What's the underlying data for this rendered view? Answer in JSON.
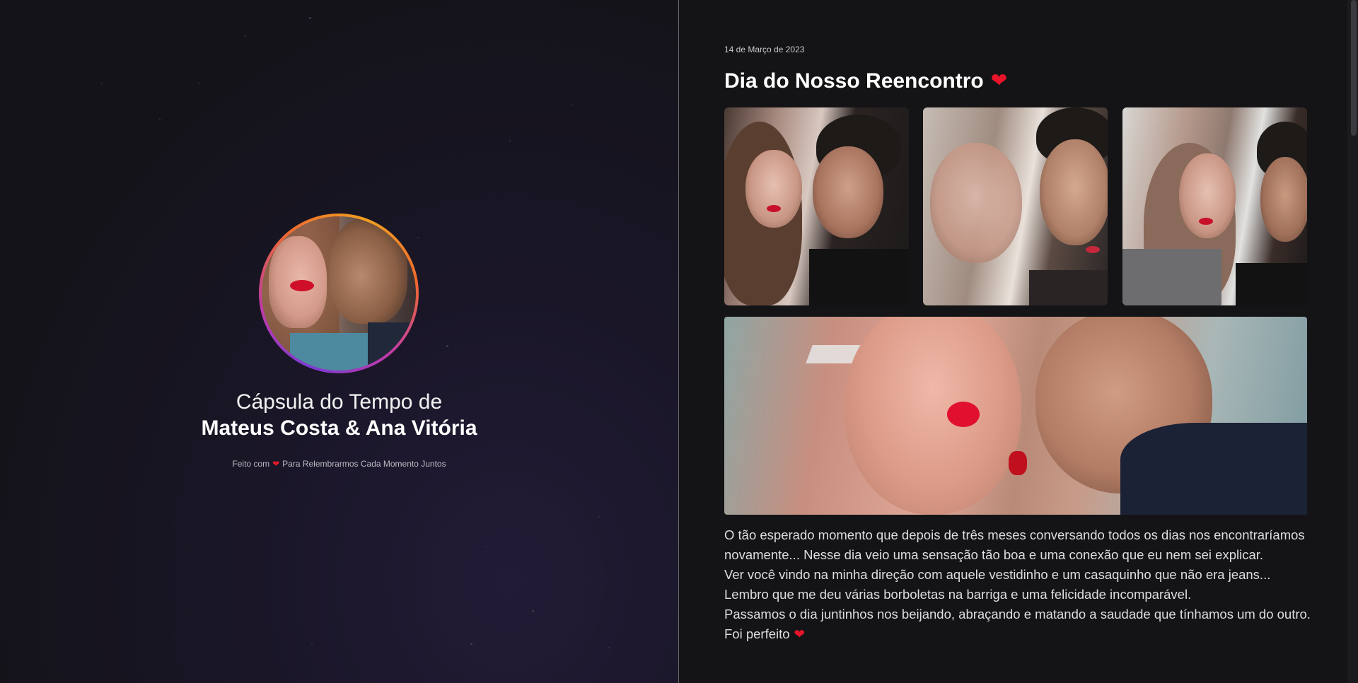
{
  "left_panel": {
    "capsule_title": "Cápsula do Tempo de",
    "couple_names": "Mateus Costa & Ana Vitória",
    "footer_prefix": "Feito com",
    "footer_heart": "❤",
    "footer_suffix": "Para Relembrarmos Cada Momento Juntos"
  },
  "entry": {
    "date": "14 de Março de 2023",
    "title": "Dia do Nosso Reencontro",
    "title_heart": "❤",
    "paragraphs": [
      "O tão esperado momento que depois de três meses conversando todos os dias nos encontraríamos novamente... Nesse dia veio uma sensação tão boa e uma conexão que eu nem sei explicar.",
      "Ver você vindo na minha direção com aquele vestidinho e um casaquinho que não era jeans... Lembro que me deu várias borboletas na barriga e uma felicidade incomparável.",
      "Passamos o dia juntinhos nos beijando, abraçando e matando a saudade que tínhamos um do outro. Foi perfeito"
    ],
    "end_heart": "❤"
  },
  "colors": {
    "accent_heart": "#e8152a",
    "avatar_ring": [
      "#7a3bd6",
      "#f06a2e",
      "#f0a020"
    ],
    "background": "#141416"
  },
  "icons": [
    "heart-icon",
    "avatar-photo"
  ]
}
